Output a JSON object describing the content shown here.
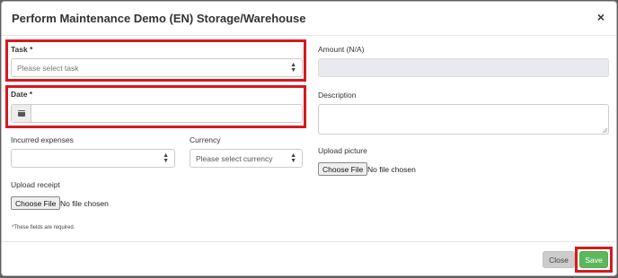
{
  "modal": {
    "title": "Perform Maintenance Demo (EN) Storage/Warehouse",
    "close_glyph": "×"
  },
  "form": {
    "task": {
      "label": "Task *",
      "placeholder": "Please select task"
    },
    "date": {
      "label": "Date *",
      "value": ""
    },
    "incurred_expenses": {
      "label": "Incurred expenses",
      "value": ""
    },
    "currency": {
      "label": "Currency",
      "placeholder": "Please select currency"
    },
    "upload_receipt": {
      "label": "Upload receipt",
      "button": "Choose File",
      "status": "No file chosen"
    },
    "amount": {
      "label": "Amount (N/A)",
      "value": ""
    },
    "description": {
      "label": "Description",
      "value": ""
    },
    "upload_picture": {
      "label": "Upload picture",
      "button": "Choose File",
      "status": "No file chosen"
    },
    "required_note": "*These fields are required."
  },
  "footer": {
    "close_label": "Close",
    "save_label": "Save"
  },
  "colors": {
    "highlight": "#d71920",
    "save": "#5cb85c",
    "close": "#cccccc"
  }
}
